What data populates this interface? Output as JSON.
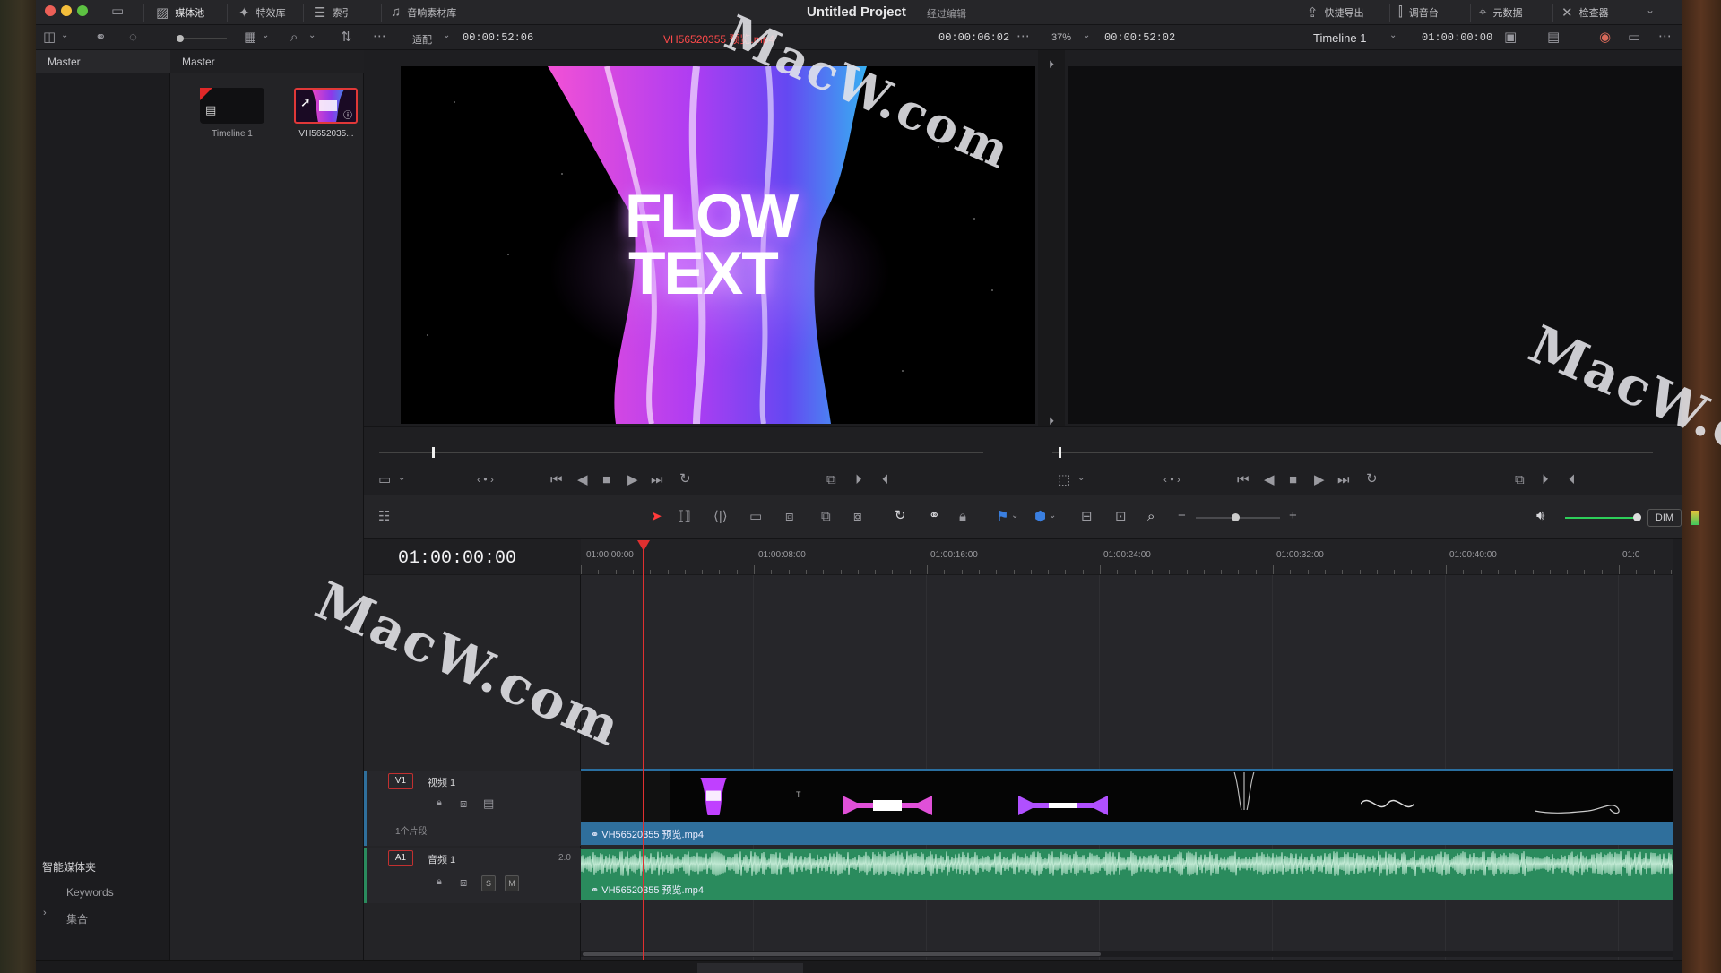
{
  "window": {
    "title": "Untitled Project",
    "subtitle": "经过编辑"
  },
  "top_nav": {
    "items": [
      {
        "label": "媒体池",
        "icon": "media-pool-icon",
        "active": true
      },
      {
        "label": "特效库",
        "icon": "effects-icon"
      },
      {
        "label": "索引",
        "icon": "index-icon"
      },
      {
        "label": "音响素材库",
        "icon": "sound-library-icon"
      }
    ],
    "right_items": [
      {
        "label": "快捷导出",
        "icon": "quick-export-icon"
      },
      {
        "label": "调音台",
        "icon": "mixer-icon"
      },
      {
        "label": "元数据",
        "icon": "metadata-icon"
      },
      {
        "label": "检查器",
        "icon": "inspector-icon"
      }
    ]
  },
  "source_viewer": {
    "fit_label": "适配",
    "duration": "00:00:52:06",
    "clip_name": "VH56520355 预览.mp4",
    "timecode": "00:00:06:02"
  },
  "timeline_viewer": {
    "zoom": "37%",
    "duration": "00:00:52:02",
    "timeline_name": "Timeline 1",
    "timecode": "01:00:00:00"
  },
  "sidebar": {
    "header": "Master",
    "smart_bins_label": "智能媒体夹",
    "keywords_label": "Keywords",
    "collections_label": "集合"
  },
  "bin": {
    "header": "Master",
    "items": [
      {
        "label": "Timeline 1"
      },
      {
        "label": "VH5652035..."
      }
    ]
  },
  "preview": {
    "line1": "FLOW",
    "line2": "TEXT"
  },
  "timeline": {
    "timecode": "01:00:00:00",
    "ruler_labels": [
      "01:00:00:00",
      "01:00:08:00",
      "01:00:16:00",
      "01:00:24:00",
      "01:00:32:00",
      "01:00:40:00",
      "01:0"
    ],
    "tracks": {
      "video": {
        "id": "V1",
        "name": "视频 1",
        "clip_count": "1个片段",
        "clip_name": "VH56520355 预览.mp4"
      },
      "audio": {
        "id": "A1",
        "name": "音频 1",
        "channels": "2.0",
        "solo": "S",
        "mute": "M",
        "clip_name": "VH56520355 预览.mp4"
      }
    },
    "dim_label": "DIM"
  },
  "watermarks": [
    "MacW.com",
    "MacW.com",
    "MacW.com"
  ],
  "colors": {
    "accent_red": "#e03030",
    "video_clip": "#2f6f9c",
    "audio_clip": "#2a8b5d",
    "clip_name_red": "#ff4a4a"
  }
}
